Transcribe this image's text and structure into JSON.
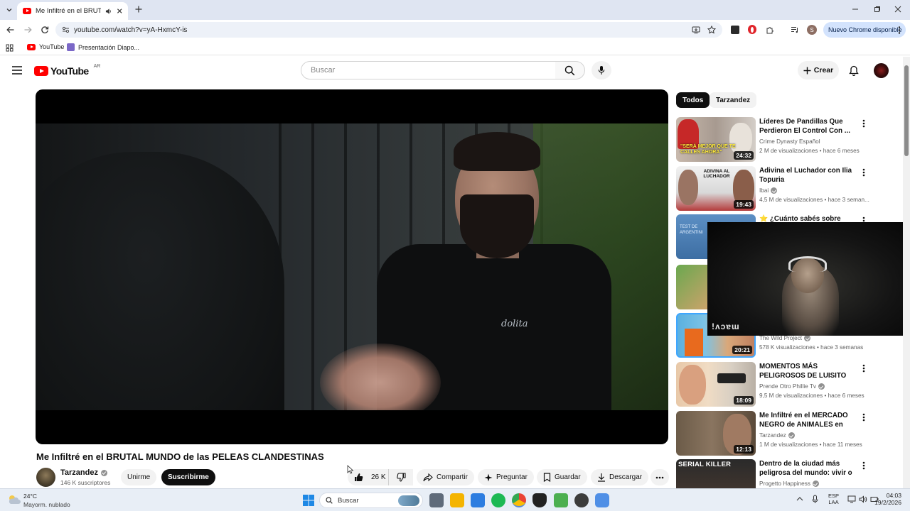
{
  "browser": {
    "tab_title": "Me Infiltré en el BRUTAL MUNDO",
    "url": "youtube.com/watch?v=yA-HxmcY-is",
    "profile_letter": "S",
    "update_label": "Nuevo Chrome disponible",
    "bookmarks": [
      "YouTube",
      "Presentación Diapo..."
    ]
  },
  "youtube": {
    "logo_text": "YouTube",
    "country_code": "AR",
    "search_placeholder": "Buscar",
    "create_label": "Crear"
  },
  "video": {
    "title": "Me Infiltré en el BRUTAL MUNDO de las PELEAS CLANDESTINAS",
    "channel_name": "Tarzandez",
    "subscribers": "146 K suscriptores",
    "join_label": "Unirme",
    "subscribe_label": "Suscribirme",
    "likes": "26 K",
    "share_label": "Compartir",
    "ask_label": "Preguntar",
    "save_label": "Guardar",
    "download_label": "Descargar",
    "shirt_text": "dolita"
  },
  "chips": [
    "Todos",
    "Tarzandez"
  ],
  "recommendations": [
    {
      "title": "Líderes De Pandillas Que Perdieron El Control Con ...",
      "channel": "Crime Dynasty Español",
      "verified": false,
      "meta": "2 M de visualizaciones • hace 6 meses",
      "duration": "24:32",
      "thumb_text": "\"SERÁ MEJOR QUE TE CALLES AHORA\""
    },
    {
      "title": "Adivina el Luchador con Ilia Topuria",
      "channel": "Ibai",
      "verified": true,
      "meta": "4,5 M de visualizaciones • hace 3 seman...",
      "duration": "19:43",
      "thumb_text": "ADIVINA AL LUCHADOR"
    },
    {
      "title": "⭐ ¿Cuánto sabés sobre",
      "channel": "",
      "verified": false,
      "meta": "",
      "duration": "",
      "thumb_text": "TEST DE ARGENTINI"
    },
    {
      "title": "",
      "channel": "",
      "verified": false,
      "meta": "",
      "duration": "",
      "thumb_text": ""
    },
    {
      "title": "",
      "channel": "The Wild Project",
      "verified": true,
      "meta": "578 K visualizaciones • hace 3 semanas",
      "duration": "20:21",
      "thumb_text": ""
    },
    {
      "title": "MOMENTOS MÁS PELIGROSOS DE LUISITO COMUNICA",
      "channel": "Prende Otro Phillie Tv",
      "verified": true,
      "meta": "9,5 M de visualizaciones • hace 6 meses",
      "duration": "18:09",
      "thumb_text": ""
    },
    {
      "title": "Me Infiltré en el MERCADO NEGRO de ANIMALES en Asia",
      "channel": "Tarzandez",
      "verified": true,
      "meta": "1 M de visualizaciones • hace 11 meses",
      "duration": "12:13",
      "thumb_text": ""
    },
    {
      "title": "Dentro de la ciudad más peligrosa del mundo: vivir o ...",
      "channel": "Progetto Happiness",
      "verified": true,
      "meta": "",
      "duration": "",
      "thumb_text": "SERIAL KILLER"
    }
  ],
  "webcam": {
    "overlay_text": "!ʌɔɐɯ"
  },
  "taskbar": {
    "temperature": "24°C",
    "weather": "Mayorm. nublado",
    "search_placeholder": "Buscar",
    "lang": "ESP",
    "layout": "LAA",
    "time": "04:03",
    "date": "19/2/2026"
  },
  "colors": {
    "youtube_red": "#ff0000",
    "subscribe_bg": "#0f0f0f",
    "chip_active_bg": "#0f0f0f",
    "chrome_update_pill": "#d3e3fd"
  }
}
